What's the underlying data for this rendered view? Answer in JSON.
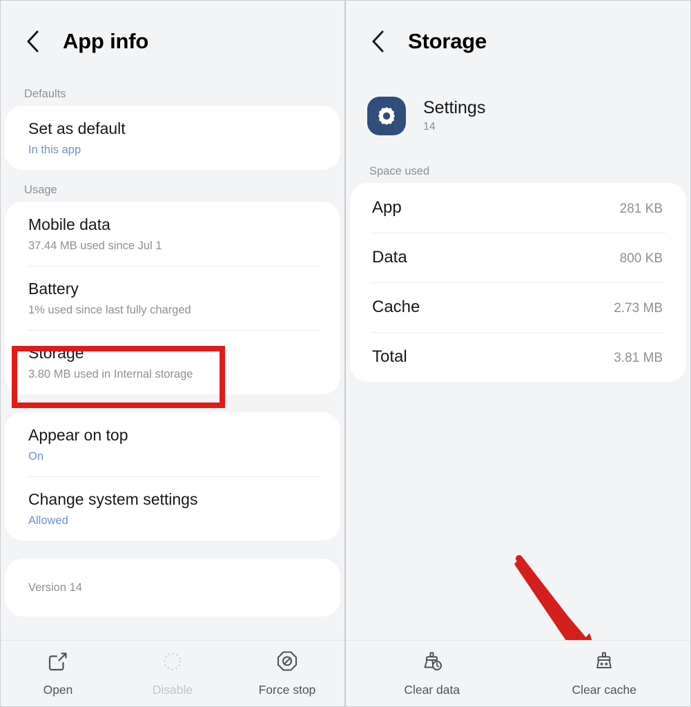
{
  "left_panel": {
    "title": "App info",
    "back_icon": "chevron-left-icon",
    "sections": [
      {
        "label": "Defaults",
        "rows": [
          {
            "title": "Set as default",
            "sub": "In this app",
            "sub_style": "link"
          }
        ]
      },
      {
        "label": "Usage",
        "rows": [
          {
            "title": "Mobile data",
            "sub": "37.44 MB used since Jul 1",
            "sub_style": "muted"
          },
          {
            "title": "Battery",
            "sub": "1% used since last fully charged",
            "sub_style": "muted"
          },
          {
            "title": "Storage",
            "sub": "3.80 MB used in Internal storage",
            "sub_style": "muted",
            "highlighted": true
          }
        ]
      },
      {
        "label": "",
        "rows": [
          {
            "title": "Appear on top",
            "sub": "On",
            "sub_style": "link"
          },
          {
            "title": "Change system settings",
            "sub": "Allowed",
            "sub_style": "link"
          }
        ]
      }
    ],
    "version_row": "Version 14",
    "bottom_buttons": [
      {
        "label": "Open",
        "icon": "open-external-icon",
        "disabled": false
      },
      {
        "label": "Disable",
        "icon": "dotted-circle-icon",
        "disabled": true
      },
      {
        "label": "Force stop",
        "icon": "force-stop-octagon-icon",
        "disabled": false
      }
    ]
  },
  "right_panel": {
    "title": "Storage",
    "back_icon": "chevron-left-icon",
    "app": {
      "icon": "settings-gear-icon",
      "name": "Settings",
      "version": "14"
    },
    "space_used_label": "Space used",
    "space_used_rows": [
      {
        "label": "App",
        "value": "281 KB"
      },
      {
        "label": "Data",
        "value": "800 KB"
      },
      {
        "label": "Cache",
        "value": "2.73 MB"
      },
      {
        "label": "Total",
        "value": "3.81 MB"
      }
    ],
    "bottom_buttons": [
      {
        "label": "Clear data",
        "icon": "clear-data-broom-clock-icon",
        "disabled": false
      },
      {
        "label": "Clear cache",
        "icon": "clear-cache-broom-sparkle-icon",
        "disabled": false
      }
    ]
  },
  "annotations": {
    "highlight_color": "#e01b18",
    "arrow_color": "#d41f1c",
    "box_target": "Storage",
    "arrow_target": "Clear cache"
  }
}
